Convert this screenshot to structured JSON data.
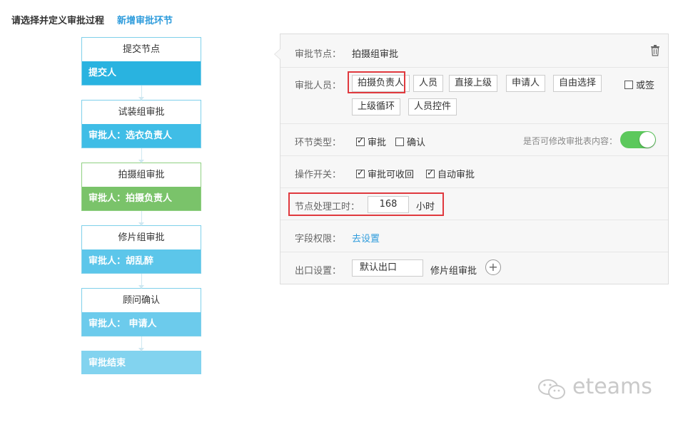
{
  "header": {
    "title": "请选择并定义审批过程",
    "add_link": "新增审批环节"
  },
  "flow": {
    "nodes": [
      {
        "name": "提交节点",
        "detail": "提交人",
        "color": "#29b3e0"
      },
      {
        "name": "试装组审批",
        "detail": "审批人：选衣负责人",
        "color": "#3fbde6"
      },
      {
        "name": "拍摄组审批",
        "detail": "审批人：拍摄负责人",
        "color": "#7ac36a"
      },
      {
        "name": "修片组审批",
        "detail": "审批人：胡乱醉",
        "color": "#5cc6ea"
      },
      {
        "name": "顾问确认",
        "detail": "审批人： 申请人",
        "color": "#6ccbec"
      }
    ],
    "end": "审批结束"
  },
  "panel": {
    "node": {
      "label": "审批节点：",
      "value": "拍摄组审批",
      "delete_icon": "trash-icon"
    },
    "approvers": {
      "label": "审批人员：",
      "options": [
        "拍摄负责人",
        "人员",
        "直接上级",
        "申请人",
        "自由选择"
      ],
      "options_row2": [
        "上级循环",
        "人员控件"
      ],
      "or_sign": "或签",
      "or_sign_checked": false
    },
    "type": {
      "label": "环节类型：",
      "approve": "审批",
      "approve_checked": true,
      "confirm": "确认",
      "confirm_checked": false,
      "editable_label": "是否可修改审批表内容：",
      "editable_on": true
    },
    "ops": {
      "label": "操作开关：",
      "recall": "审批可收回",
      "recall_checked": true,
      "auto": "自动审批",
      "auto_checked": true
    },
    "time": {
      "label": "节点处理工时：",
      "value": "168",
      "unit": "小时"
    },
    "fields": {
      "label": "字段权限：",
      "link": "去设置"
    },
    "exit": {
      "label": "出口设置：",
      "default": "默认出口",
      "target": "修片组审批"
    }
  },
  "colors": {
    "highlight": "#e0393e",
    "link": "#2f9cdc",
    "toggle": "#5cc85c"
  },
  "watermark": "eteams"
}
